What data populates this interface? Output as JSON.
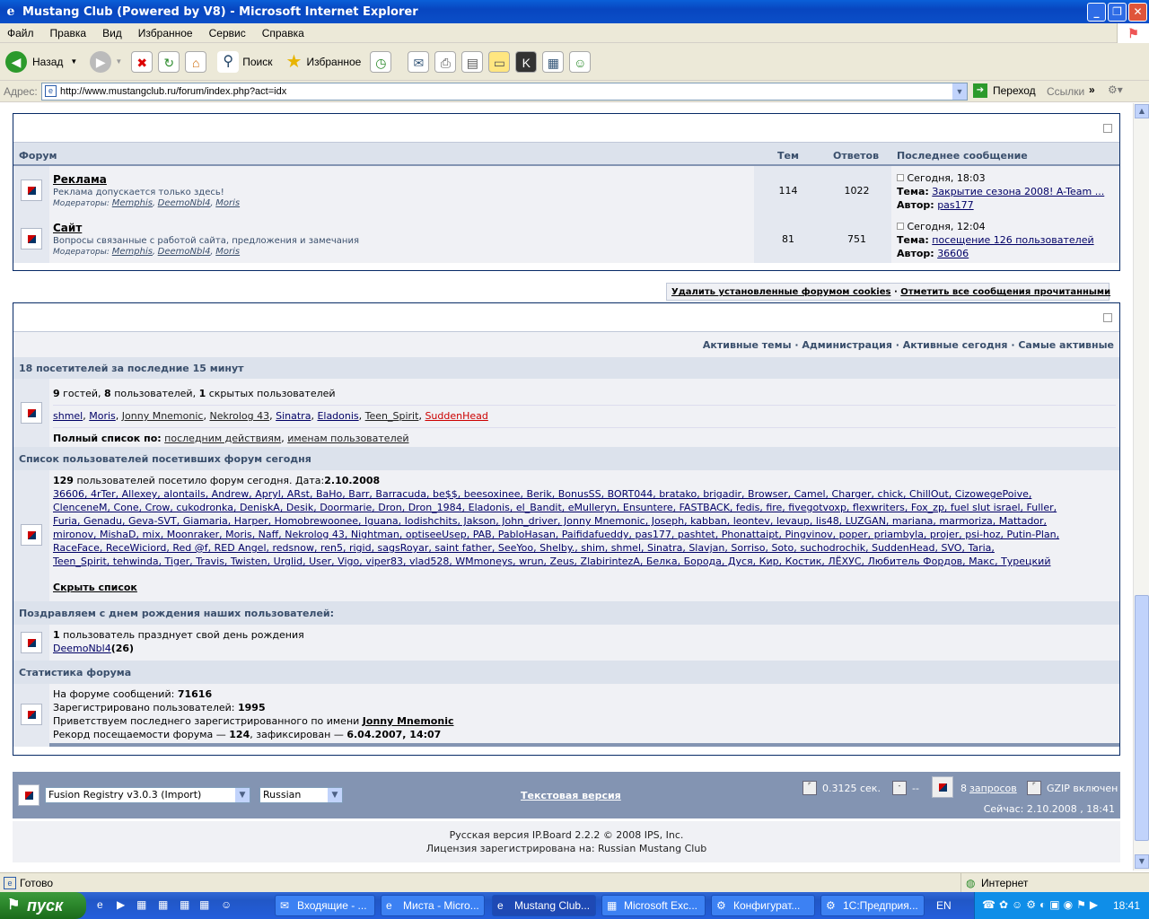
{
  "window": {
    "title": "Mustang Club (Powered by V8) - Microsoft Internet Explorer"
  },
  "menu": [
    "Файл",
    "Правка",
    "Вид",
    "Избранное",
    "Сервис",
    "Справка"
  ],
  "toolbar": {
    "back": "Назад",
    "search": "Поиск",
    "favorites": "Избранное"
  },
  "address": {
    "label": "Адрес:",
    "url": "http://www.mustangclub.ru/forum/index.php?act=idx",
    "go": "Переход",
    "links": "Ссылки"
  },
  "forums": {
    "headers": {
      "forum": "Форум",
      "topics": "Тем",
      "replies": "Ответов",
      "last": "Последнее сообщение"
    },
    "rows": [
      {
        "name": "Реклама",
        "desc": "Реклама допускается только здесь!",
        "mods_label": "Модераторы:",
        "mods": [
          "Memphis",
          "DeemoNbl4",
          "Moris"
        ],
        "topics": "114",
        "replies": "1022",
        "last_date": "Сегодня, 18:03",
        "last_topic_label": "Тема:",
        "last_topic": "Закрытие сезона 2008! A-Team ...",
        "last_author_label": "Автор:",
        "last_author": "pas177"
      },
      {
        "name": "Сайт",
        "desc": "Вопросы связанные с работой сайта, предложения и замечания",
        "mods_label": "Модераторы:",
        "mods": [
          "Memphis",
          "DeemoNbl4",
          "Moris"
        ],
        "topics": "81",
        "replies": "751",
        "last_date": "Сегодня, 12:04",
        "last_topic_label": "Тема:",
        "last_topic": "посещение 126 пользователей",
        "last_author_label": "Автор:",
        "last_author": "36606"
      }
    ]
  },
  "cookies": {
    "delete": "Удалить установленные форумом cookies",
    "sep": "·",
    "mark": "Отметить все сообщения прочитанными"
  },
  "stats": {
    "links": [
      "Активные темы",
      "Администрация",
      "Активные сегодня",
      "Самые активные"
    ],
    "online_title": "18 посетителей за последние 15 минут",
    "online_summary": {
      "guests": "9",
      "guests_label": "гостей,",
      "users": "8",
      "users_label": "пользователей,",
      "hidden": "1",
      "hidden_label": "скрытых пользователей"
    },
    "online_users": [
      "shmel",
      "Moris",
      "Jonny Mnemonic",
      "Nekrolog 43",
      "Sinatra",
      "Eladonis",
      "Teen_Spirit",
      "SuddenHead"
    ],
    "full_list_label": "Полный список по:",
    "full_list_a": "последним действиям",
    "full_list_b": "именам пользователей",
    "today_title": "Список пользователей посетивших форум сегодня",
    "today_count": "129",
    "today_text": "пользователей посетило форум сегодня. Дата:",
    "today_date": "2.10.2008",
    "today_lines": [
      "36606, 4rTer, Allexey, alontails, Andrew, Apryl, ARst, BaHo, Barr, Barracuda, be$$, beesoxinee, Berik, BonusSS, BORT044, bratako, brigadir, Browser, Camel, Charger, chick, ChillOut, CizowegePoive,",
      "ClenceneM, Cone, Crow, cukodronka, DeniskA, Desik, Doormarie, Dron, Dron_1984, Eladonis, el_Bandit, eMulleryn, Ensuntere, FASTBACK, fedis, fire, fivegotvoxp, flexwriters, Fox_zp, fuel slut israel, Fuller,",
      "Furia, Genadu, Geva-SVT, Giamaria, Harper, Homobrewoonee, Iguana, Iodishchits, Jakson, John_driver, Jonny Mnemonic, Joseph, kabban, leontev, levaup, lis48, LUZGAN, mariana, marmoriza, Mattador,",
      "mironov, MishaD, mix, Moonraker, Moris, Naff, Nekrolog 43, Nightman, optiseeUsep, PAB, PabloHasan, Paifidafueddy, pas177, pashtet, Phonattaipt, Pingvinov, poper, priambyla, projer, psi-hoz, Putin-Plan,",
      "RaceFace, ReceWiciord, Red @f, RED Angel, redsnow, ren5, rigid, sagsRoyar, saint father, SeeYoo, Shelby., shim, shmel, Sinatra, Slavjan, Sorriso, Soto, suchodrochik, SuddenHead, SVO, Taria,",
      "Teen_Spirit, tehwinda, Tiger, Travis, Twisten, Urglid, User, Vigo, viper83, vlad528, WMmoneys, wrun, Zeus, ZlabirintezA, Белка, Борода, Дуся, Кир, Костик, ЛЁХУС, Любитель Фордов, Макс, Турецкий"
    ],
    "hide_list": "Скрыть список",
    "bday_title": "Поздравляем с днем рождения наших пользователей:",
    "bday_count": "1",
    "bday_text": "пользователь празднует свой день рождения",
    "bday_user": "DeemoNbl4",
    "bday_age": "(26)",
    "forum_stats_title": "Статистика форума",
    "posts_label": "На форуме сообщений:",
    "posts": "71616",
    "users_label": "Зарегистрировано пользователей:",
    "users": "1995",
    "newest_label": "Приветствуем последнего зарегистрированного по имени",
    "newest": "Jonny Mnemonic",
    "record_label": "Рекорд посещаемости форума —",
    "record": "124",
    "record_mid": ", зафиксирован —",
    "record_date": "6.04.2007, 14:07"
  },
  "footer": {
    "skin": "Fusion Registry v3.0.3 (Import)",
    "lang": "Russian",
    "text_version": "Текстовая версия",
    "time": "0.3125 сек.",
    "dash": "--",
    "queries_pre": "8",
    "queries": "запросов",
    "gzip": "GZIP включен",
    "now": "Сейчас: 2.10.2008 , 18:41",
    "copyright": "Русская версия IP.Board 2.2.2 © 2008  IPS, Inc.",
    "license": "Лицензия зарегистрирована на: Russian Mustang Club"
  },
  "status": {
    "text": "Готово",
    "zone": "Интернет"
  },
  "taskbar": {
    "start": "пуск",
    "tasks": [
      "Входящие - ...",
      "Миста - Micro...",
      "Mustang Club...",
      "Microsoft Exc...",
      "Конфигурат...",
      "1С:Предприя..."
    ],
    "lang": "EN",
    "clock": "18:41"
  }
}
